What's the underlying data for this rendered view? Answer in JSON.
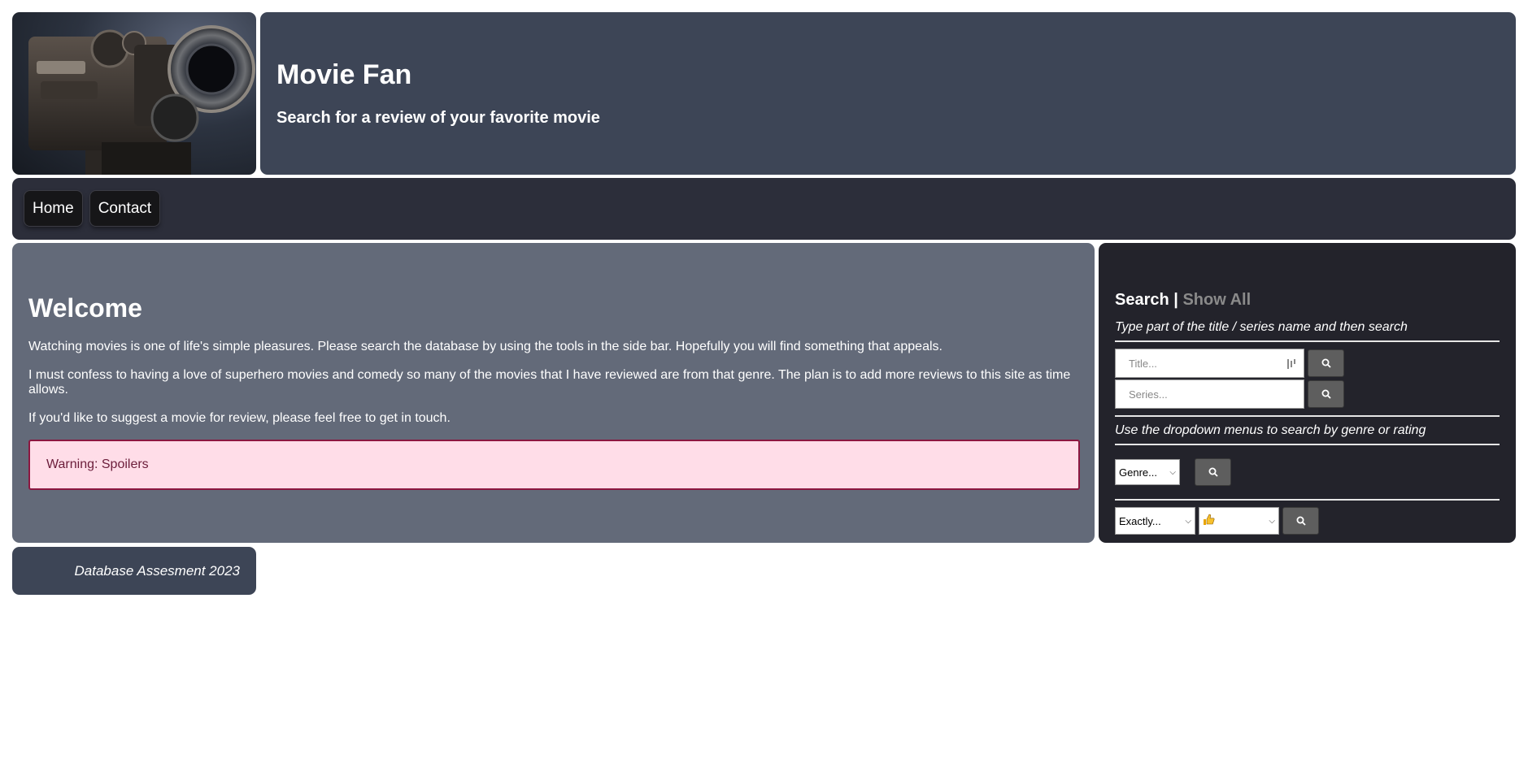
{
  "header": {
    "title": "Movie Fan",
    "subtitle": "Search for a review of your favorite movie"
  },
  "nav": {
    "home": "Home",
    "contact": "Contact"
  },
  "main": {
    "title": "Welcome",
    "paragraphs": [
      "Watching movies is one of life's simple pleasures. Please search the database by using the tools in the side bar. Hopefully you will find something that appeals.",
      "I must confess to having a love of superhero movies and comedy so many of the movies that I have reviewed are from that genre. The plan is to add more reviews to this site as time allows.",
      "If you'd like to suggest a movie for review, please feel free to get in touch."
    ],
    "warning": "Warning: Spoilers"
  },
  "sidebar": {
    "tab_search": "Search",
    "separator": "|",
    "tab_show_all": "Show All",
    "hint_text": "Type part of the title / series name and then search",
    "title_placeholder": "Title...",
    "series_placeholder": "Series...",
    "hint_dropdown": "Use the dropdown menus to search by genre or rating",
    "genre_selected": "Genre...",
    "exact_selected": "Exactly...",
    "rating_selected_icon": "thumbs-up-icon"
  },
  "footer": {
    "text": "Database Assesment 2023"
  },
  "colors": {
    "header_bg": "#3d4556",
    "nav_bg": "#2c2e3a",
    "main_bg": "#636a79",
    "sidebar_bg": "#23232b",
    "warning_bg": "#ffdde8",
    "warning_border": "#8c1740",
    "button_bg": "#5e5e5e"
  }
}
